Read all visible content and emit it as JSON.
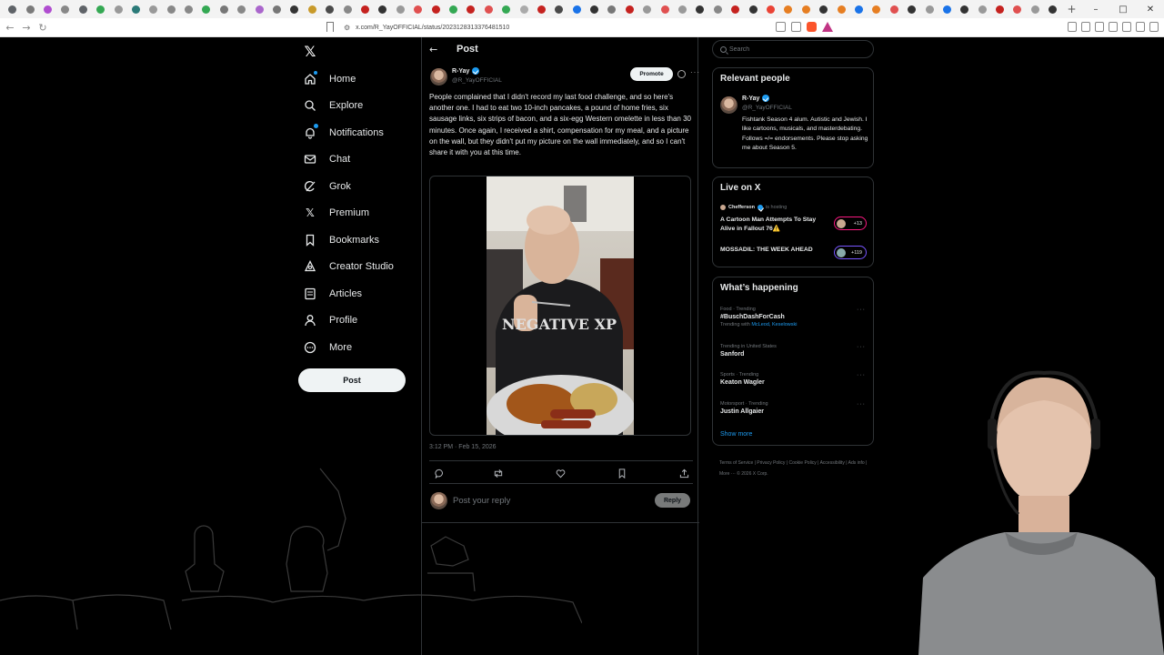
{
  "browser": {
    "url": "x.com/R_YayOFFICIAL/status/2023128313376481510",
    "tab_colors": [
      "#5f6368",
      "#7a7a7a",
      "#b04dd0",
      "#888",
      "#5f6368",
      "#34a853",
      "#999",
      "#2b7a78",
      "#999",
      "#888",
      "#888",
      "#34a853",
      "#777",
      "#888",
      "#aa66cc",
      "#777",
      "#333",
      "#c89a2a",
      "#4a4a4a",
      "#888",
      "#c5221f",
      "#333",
      "#999",
      "#e05050",
      "#c5221f",
      "#34a853",
      "#c5221f",
      "#e05050",
      "#34a853",
      "#aaa",
      "#c5221f",
      "#4a4a4a",
      "#1a73e8",
      "#333",
      "#777",
      "#c5221f",
      "#999",
      "#e05050",
      "#999",
      "#333",
      "#888",
      "#c5221f",
      "#333",
      "#ea4335",
      "#e67e22",
      "#e67e22",
      "#333",
      "#e67e22",
      "#1a73e8",
      "#e67e22",
      "#e05050",
      "#333",
      "#999",
      "#1a73e8",
      "#333",
      "#999",
      "#c5221f",
      "#e05050",
      "#999",
      "#333"
    ]
  },
  "nav": {
    "items": [
      {
        "label": "Home",
        "icon": "home-icon",
        "badge": true
      },
      {
        "label": "Explore",
        "icon": "search-icon",
        "badge": false
      },
      {
        "label": "Notifications",
        "icon": "bell-icon",
        "badge": true
      },
      {
        "label": "Chat",
        "icon": "mail-icon",
        "badge": false
      },
      {
        "label": "Grok",
        "icon": "grok-icon",
        "badge": false
      },
      {
        "label": "Premium",
        "icon": "x-premium-icon",
        "badge": false
      },
      {
        "label": "Bookmarks",
        "icon": "bookmark-icon",
        "badge": false
      },
      {
        "label": "Creator Studio",
        "icon": "creator-studio-icon",
        "badge": false
      },
      {
        "label": "Articles",
        "icon": "articles-icon",
        "badge": false
      },
      {
        "label": "Profile",
        "icon": "person-icon",
        "badge": false
      },
      {
        "label": "More",
        "icon": "more-circle-icon",
        "badge": false
      }
    ],
    "post_button": "Post"
  },
  "post": {
    "header_title": "Post",
    "author_name": "R-Yay",
    "author_handle": "@R_YayOFFICIAL",
    "promote_label": "Promote",
    "text": "People complained that I didn't record my last food challenge, and so here's another one. I had to eat two 10-inch pancakes, a pound of home fries, six sausage links, six strips of bacon, and a six-egg Western omelette in less than 30 minutes. Once again, I received a shirt, compensation for my meal, and a picture on the wall, but they didn't put my picture on the wall immediately, and so I can't share it with you at this time.",
    "timestamp": "3:12 PM · Feb 15, 2026",
    "reply_placeholder": "Post your reply",
    "reply_button": "Reply",
    "video_shirt_text": "NEGATIVE XP"
  },
  "sidebar": {
    "search_placeholder": "Search",
    "relevant_people": {
      "title": "Relevant people",
      "name": "R-Yay",
      "handle": "@R_YayOFFICIAL",
      "bio": "Fishtank Season 4 alum. Autistic and Jewish. I like cartoons, musicals, and masterdebating. Follows =/= endorsements. Please stop asking me about Season 5."
    },
    "live": {
      "title": "Live on X",
      "host_name": "Chefferson",
      "hosting_label": "is hosting",
      "spaces": [
        {
          "title": "A Cartoon Man Attempts To Stay Alive in Fallout 76⚠️",
          "count": "+13",
          "color": "#f91880"
        },
        {
          "title": "MOSSADIL: THE WEEK AHEAD",
          "count": "+119",
          "color": "#7856ff"
        }
      ]
    },
    "happening": {
      "title": "What’s happening",
      "trends": [
        {
          "context": "Food · Trending",
          "name": "#BuschDashForCash",
          "with_prefix": "Trending with ",
          "with_links": "McLeod, Keselowski"
        },
        {
          "context": "Trending in United States",
          "name": "Sanford",
          "with_prefix": "",
          "with_links": ""
        },
        {
          "context": "Sports · Trending",
          "name": "Keaton Wagler",
          "with_prefix": "",
          "with_links": ""
        },
        {
          "context": "Motorsport · Trending",
          "name": "Justin Allgaier",
          "with_prefix": "",
          "with_links": ""
        }
      ],
      "show_more": "Show more"
    },
    "footer": "Terms of Service  |  Privacy Policy  |  Cookie Policy  |  Accessibility  |  Ads info  |  More ···  © 2026 X Corp."
  },
  "colors": {
    "background": "#000000",
    "text": "#e7e9ea",
    "muted": "#71767b",
    "border": "#2f3336",
    "accent": "#1d9bf0"
  }
}
